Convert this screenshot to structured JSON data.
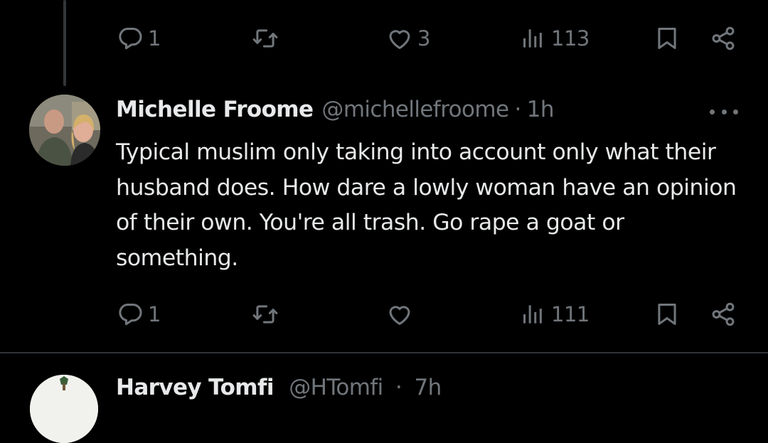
{
  "previous_tweet": {
    "actions": {
      "reply_count": "1",
      "retweet_count": "",
      "like_count": "3",
      "view_count": "113"
    }
  },
  "tweet": {
    "author_name": "Michelle Froome",
    "author_handle": "@michellefroome",
    "separator": "·",
    "timestamp": "1h",
    "body": "Typical muslim only taking into account only what their husband does. How dare a lowly woman have an opinion of their own. You're all trash. Go rape a goat or something.",
    "actions": {
      "reply_count": "1",
      "retweet_count": "",
      "like_count": "",
      "view_count": "111"
    }
  },
  "next_tweet": {
    "author_name_partial": "Harvey Tomfi",
    "author_handle_partial": "@HTomfi",
    "separator": "·",
    "timestamp": "7h"
  },
  "colors": {
    "background": "#000000",
    "primary_text": "#e7e9ea",
    "secondary_text": "#71767b",
    "divider": "#2f3336"
  }
}
